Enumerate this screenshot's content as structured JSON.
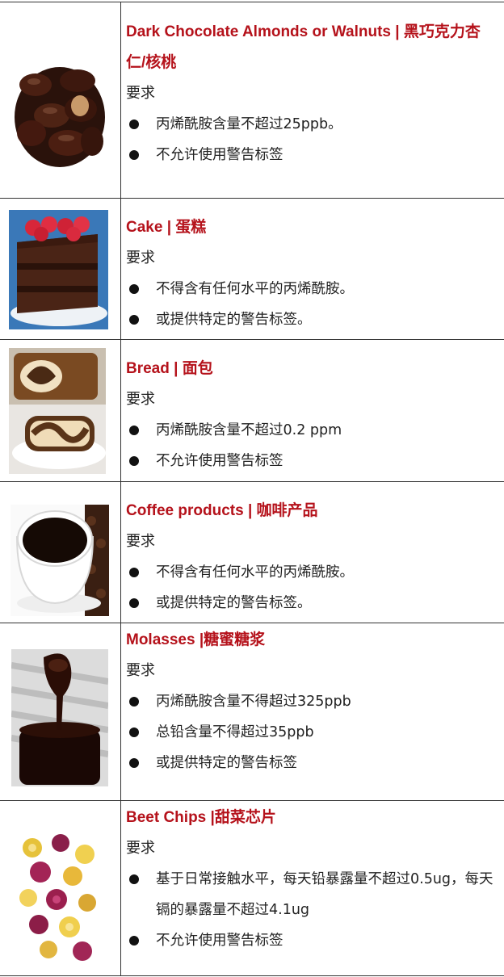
{
  "rows": [
    {
      "title": "Dark Chocolate Almonds or Walnuts | 黑巧克力杏仁/核桃",
      "requirement_label": "要求",
      "bullets": [
        "丙烯酰胺含量不超过25ppb。",
        "不允许使用警告标签"
      ],
      "image": "chocolate-almonds-image"
    },
    {
      "title": "Cake | 蛋糕",
      "requirement_label": "要求",
      "bullets": [
        "不得含有任何水平的丙烯酰胺。",
        "或提供特定的警告标签。"
      ],
      "image": "chocolate-cake-image"
    },
    {
      "title": "Bread | 面包",
      "requirement_label": "要求",
      "bullets": [
        "丙烯酰胺含量不超过0.2 ppm",
        "不允许使用警告标签"
      ],
      "image": "marble-bread-image"
    },
    {
      "title": "Coffee products | 咖啡产品",
      "requirement_label": "要求",
      "bullets": [
        "不得含有任何水平的丙烯酰胺。",
        "或提供特定的警告标签。"
      ],
      "image": "coffee-cup-image"
    },
    {
      "title": "Molasses |糖蜜糖浆",
      "requirement_label": "要求",
      "bullets": [
        "丙烯酰胺含量不得超过325ppb",
        "总铅含量不得超过35ppb",
        "或提供特定的警告标签"
      ],
      "image": "molasses-spoon-image"
    },
    {
      "title": "Beet Chips |甜菜芯片",
      "requirement_label": "要求",
      "bullets": [
        "基于日常接触水平，每天铅暴露量不超过0.5ug，每天镉的暴露量不超过4.1ug",
        "不允许使用警告标签"
      ],
      "image": "beet-chips-image"
    }
  ],
  "colors": {
    "title": "#b5121b",
    "border": "#333333",
    "text": "#222222"
  }
}
